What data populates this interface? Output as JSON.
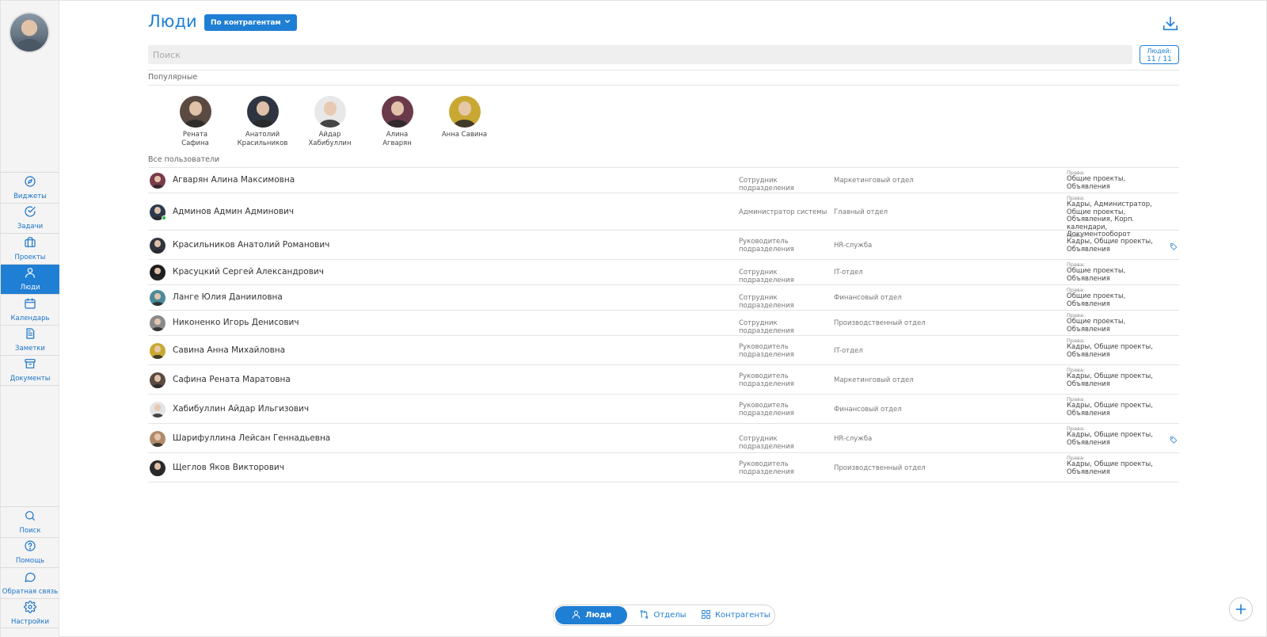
{
  "colors": {
    "accent": "#1f7fd4",
    "online": "#28b446"
  },
  "sidebar": {
    "top_items": [
      {
        "label": "Виджеты",
        "icon": "compass-icon"
      },
      {
        "label": "Задачи",
        "icon": "check-circle-icon"
      },
      {
        "label": "Проекты",
        "icon": "briefcase-icon"
      },
      {
        "label": "Люди",
        "icon": "person-icon",
        "active": true
      },
      {
        "label": "Календарь",
        "icon": "calendar-icon"
      },
      {
        "label": "Заметки",
        "icon": "note-icon"
      },
      {
        "label": "Документы",
        "icon": "archive-icon"
      }
    ],
    "bottom_items": [
      {
        "label": "Поиск",
        "icon": "search-icon"
      },
      {
        "label": "Помощь",
        "icon": "help-icon"
      },
      {
        "label": "Обратная связь",
        "icon": "chat-bubble-icon"
      },
      {
        "label": "Настройки",
        "icon": "gear-icon"
      }
    ]
  },
  "header": {
    "title": "Люди",
    "filter_label": "По контрагентам",
    "download_icon": "download-icon"
  },
  "search": {
    "placeholder": "Поиск"
  },
  "counter": {
    "label": "Людей:",
    "value": "11 / 11"
  },
  "popular": {
    "label": "Популярные",
    "people": [
      {
        "line1": "Рената",
        "line2": "Сафина",
        "color": "#5a4a42"
      },
      {
        "line1": "Анатолий",
        "line2": "Красильников",
        "color": "#2f3540"
      },
      {
        "line1": "Айдар",
        "line2": "Хабибуллин",
        "color": "#e8e8e8"
      },
      {
        "line1": "Алина",
        "line2": "Агварян",
        "color": "#6b3a4a"
      },
      {
        "line1": "Анна Савина",
        "line2": "",
        "color": "#c8a832"
      }
    ]
  },
  "all_users": {
    "label": "Все пользователи",
    "rights_caption": "Права:",
    "rows": [
      {
        "name": "Агварян Алина Максимовна",
        "role": "Сотрудник подразделения",
        "dept": "Маркетинговый отдел",
        "rights": "Общие проекты, Объявления",
        "color": "#7a3b4a",
        "online": false,
        "tag": false
      },
      {
        "name": "Админов Админ Админович",
        "role": "Администратор системы",
        "dept": "Главный отдел",
        "rights": "Кадры, Администратор, Общие проекты, Объявления, Корп. календари, Документооборот",
        "color": "#2c3a4e",
        "online": true,
        "tag": false
      },
      {
        "name": "Красильников Анатолий Романович",
        "role": "Руководитель подразделения",
        "dept": "HR-служба",
        "rights": "Кадры, Общие проекты, Объявления",
        "color": "#30363f",
        "online": false,
        "tag": true
      },
      {
        "name": "Красуцкий Сергей Александрович",
        "role": "Сотрудник подразделения",
        "dept": "IT-отдел",
        "rights": "Общие проекты, Объявления",
        "color": "#1e1e1e",
        "online": false,
        "tag": false
      },
      {
        "name": "Ланге Юлия Данииловна",
        "role": "Сотрудник подразделения",
        "dept": "Финансовый отдел",
        "rights": "Общие проекты, Объявления",
        "color": "#4a8a9a",
        "online": false,
        "tag": false
      },
      {
        "name": "Никоненко Игорь Денисович",
        "role": "Сотрудник подразделения",
        "dept": "Производственный отдел",
        "rights": "Общие проекты, Объявления",
        "color": "#8a8a8a",
        "online": false,
        "tag": false
      },
      {
        "name": "Савина Анна Михайловна",
        "role": "Руководитель подразделения",
        "dept": "IT-отдел",
        "rights": "Кадры, Общие проекты, Объявления",
        "color": "#c8a832",
        "online": false,
        "tag": false
      },
      {
        "name": "Сафина Рената Маратовна",
        "role": "Руководитель подразделения",
        "dept": "Маркетинговый отдел",
        "rights": "Кадры, Общие проекты, Объявления",
        "color": "#5a4a42",
        "online": false,
        "tag": false
      },
      {
        "name": "Хабибуллин Айдар Ильгизович",
        "role": "Руководитель подразделения",
        "dept": "Финансовый отдел",
        "rights": "Кадры, Общие проекты, Объявления",
        "color": "#e4e4e4",
        "online": false,
        "tag": false
      },
      {
        "name": "Шарифуллина Лейсан Геннадьевна",
        "role": "Сотрудник подразделения",
        "dept": "HR-служба",
        "rights": "Кадры, Общие проекты, Объявления",
        "color": "#b08a6a",
        "online": false,
        "tag": true
      },
      {
        "name": "Щеглов Яков Викторович",
        "role": "Руководитель подразделения",
        "dept": "Производственный отдел",
        "rights": "Кадры, Общие проекты, Объявления",
        "color": "#2a2a2a",
        "online": false,
        "tag": false
      }
    ]
  },
  "switcher": {
    "tabs": [
      {
        "label": "Люди",
        "icon": "person-icon",
        "active": true
      },
      {
        "label": "Отделы",
        "icon": "branches-icon",
        "active": false
      },
      {
        "label": "Контрагенты",
        "icon": "grid-icon",
        "active": false
      }
    ]
  },
  "fab": {
    "icon": "plus-icon"
  }
}
